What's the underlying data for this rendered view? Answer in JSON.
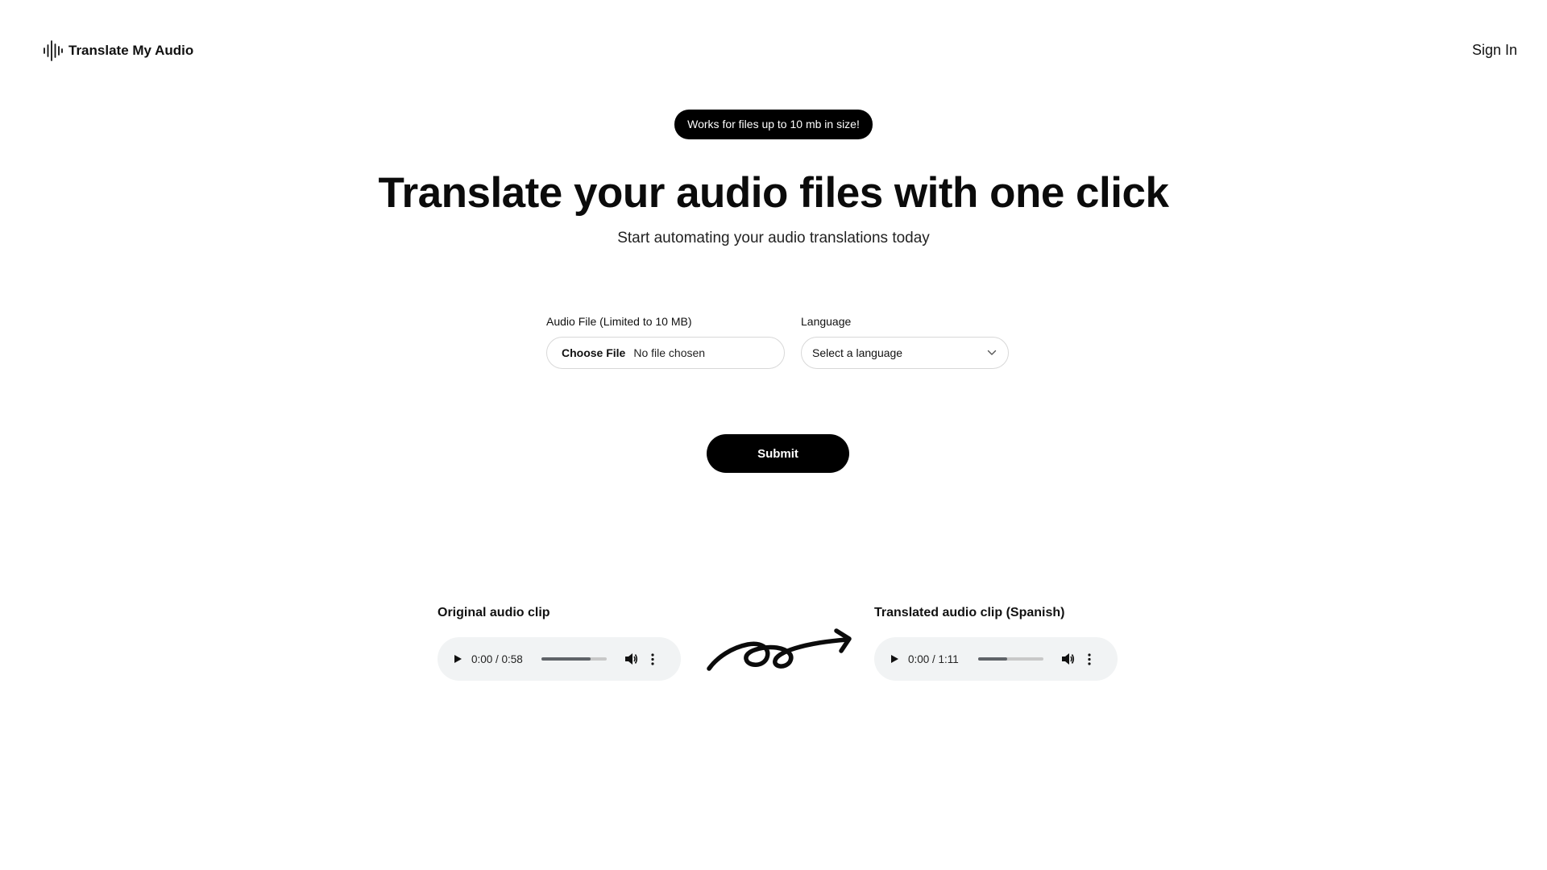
{
  "header": {
    "logo_text": "Translate My Audio",
    "logo_icon": "waveform-icon",
    "signin_label": "Sign In"
  },
  "hero": {
    "badge": "Works for files up to 10 mb in size!",
    "title": "Translate your audio files with one click",
    "subtitle": "Start automating your audio translations today"
  },
  "form": {
    "file_label": "Audio File (Limited to 10 MB)",
    "file_button": "Choose File",
    "file_status": "No file chosen",
    "language_label": "Language",
    "language_value": "Select a language",
    "submit_label": "Submit"
  },
  "clips": {
    "original": {
      "label": "Original audio clip",
      "time": "0:00 / 0:58",
      "volume_level": 0.75
    },
    "translated": {
      "label": "Translated audio clip (Spanish)",
      "time": "0:00 / 1:11",
      "volume_level": 0.45
    }
  },
  "colors": {
    "primary": "#000000",
    "background": "#ffffff",
    "player_bg": "#f1f3f4"
  }
}
